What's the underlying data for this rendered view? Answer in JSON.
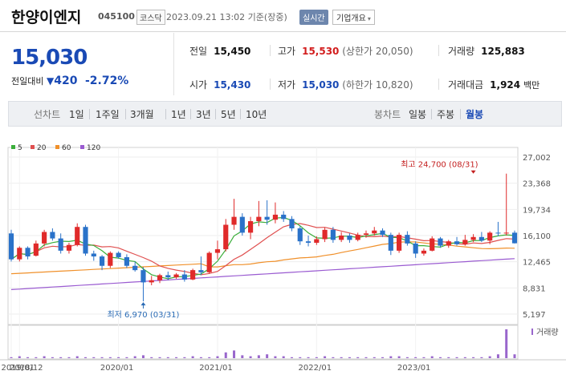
{
  "header": {
    "name": "한양이엔지",
    "code": "045100",
    "market": "코스닥",
    "datetime": "2023.09.21 13:02 기준(장중)",
    "realtime_label": "실시간",
    "company_info": "기업개요"
  },
  "summary": {
    "price": "15,030",
    "change_label": "전일대비",
    "change_arrow": "▼",
    "change_amount": "420",
    "change_pct": "-2.72%",
    "prev_label": "전일",
    "prev_value": "15,450",
    "high_label": "고가",
    "high_value": "15,530",
    "upper_limit": "(상한가 20,050)",
    "volume_label": "거래량",
    "volume_value": "125,883",
    "open_label": "시가",
    "open_value": "15,430",
    "low_label": "저가",
    "low_value": "15,030",
    "lower_limit": "(하한가 10,820)",
    "amount_label": "거래대금",
    "amount_value": "1,924",
    "amount_unit": "백만"
  },
  "periods": {
    "line_label": "선차트",
    "line_items": [
      "1일",
      "1주일",
      "3개월",
      "1년",
      "3년",
      "5년",
      "10년"
    ],
    "candle_label": "봉차트",
    "candle_items": [
      "일봉",
      "주봉",
      "월봉"
    ],
    "selected_candle": "월봉"
  },
  "chart_data": {
    "type": "candlestick",
    "interval": "monthly",
    "legend": [
      {
        "name": "5",
        "color": "#3aae3a"
      },
      {
        "name": "20",
        "color": "#e05050"
      },
      {
        "name": "60",
        "color": "#f0902a"
      },
      {
        "name": "120",
        "color": "#9a5bd1"
      }
    ],
    "colors": {
      "up": "#e02a2a",
      "down": "#2a72c9",
      "ma5": "#3aae3a",
      "ma20": "#e05050",
      "ma60": "#f0902a",
      "ma120": "#9a5bd1",
      "volume": "#9966cc"
    },
    "y_ticks": [
      "27,002",
      "23,368",
      "19,734",
      "16,100",
      "12,465",
      "8,831",
      "5,197"
    ],
    "y_tick_values": [
      27002,
      23368,
      19734,
      16100,
      12465,
      8831,
      5197
    ],
    "ylim": [
      5197,
      27002
    ],
    "x_labels": [
      "2018/12",
      "2019/01",
      "2020/01",
      "2021/01",
      "2022/01",
      "2023/01"
    ],
    "x_label_index": [
      0,
      1,
      13,
      25,
      37,
      49
    ],
    "annotations": {
      "high_label": "최고 24,700 (08/31)",
      "high_value": 24700,
      "high_index": 56,
      "low_label": "최저 6,970 (03/31)",
      "low_value": 6970,
      "low_index": 16
    },
    "volume_label": "거래량",
    "candles": [
      {
        "o": 16400,
        "h": 16900,
        "l": 12500,
        "c": 12800
      },
      {
        "o": 12800,
        "h": 14600,
        "l": 12500,
        "c": 14400
      },
      {
        "o": 14400,
        "h": 14600,
        "l": 12800,
        "c": 13200
      },
      {
        "o": 13300,
        "h": 15400,
        "l": 13200,
        "c": 15000
      },
      {
        "o": 15000,
        "h": 16900,
        "l": 14600,
        "c": 16600
      },
      {
        "o": 16600,
        "h": 17100,
        "l": 15400,
        "c": 15700
      },
      {
        "o": 15700,
        "h": 16400,
        "l": 13600,
        "c": 14000
      },
      {
        "o": 14000,
        "h": 15100,
        "l": 13600,
        "c": 14800
      },
      {
        "o": 14800,
        "h": 17800,
        "l": 14600,
        "c": 17300
      },
      {
        "o": 17300,
        "h": 17600,
        "l": 13300,
        "c": 13600
      },
      {
        "o": 13600,
        "h": 14000,
        "l": 12600,
        "c": 13200
      },
      {
        "o": 13200,
        "h": 13400,
        "l": 11300,
        "c": 11900
      },
      {
        "o": 11900,
        "h": 13900,
        "l": 11600,
        "c": 13700
      },
      {
        "o": 13700,
        "h": 13900,
        "l": 12900,
        "c": 13100
      },
      {
        "o": 13100,
        "h": 13500,
        "l": 11600,
        "c": 11900
      },
      {
        "o": 11900,
        "h": 12500,
        "l": 11100,
        "c": 11300
      },
      {
        "o": 11300,
        "h": 11700,
        "l": 6970,
        "c": 9600
      },
      {
        "o": 9600,
        "h": 10500,
        "l": 9200,
        "c": 9900
      },
      {
        "o": 9900,
        "h": 10800,
        "l": 9500,
        "c": 10600
      },
      {
        "o": 10600,
        "h": 11100,
        "l": 9900,
        "c": 10300
      },
      {
        "o": 10300,
        "h": 10900,
        "l": 10100,
        "c": 10700
      },
      {
        "o": 10700,
        "h": 11300,
        "l": 9700,
        "c": 10000
      },
      {
        "o": 10000,
        "h": 11500,
        "l": 9900,
        "c": 11300
      },
      {
        "o": 11300,
        "h": 13200,
        "l": 10600,
        "c": 11000
      },
      {
        "o": 11000,
        "h": 13900,
        "l": 10800,
        "c": 13700
      },
      {
        "o": 13700,
        "h": 15400,
        "l": 12800,
        "c": 14200
      },
      {
        "o": 14200,
        "h": 18400,
        "l": 13900,
        "c": 17600
      },
      {
        "o": 17600,
        "h": 21200,
        "l": 16900,
        "c": 18700
      },
      {
        "o": 18700,
        "h": 19200,
        "l": 16100,
        "c": 16500
      },
      {
        "o": 16500,
        "h": 18700,
        "l": 15600,
        "c": 18100
      },
      {
        "o": 18100,
        "h": 20900,
        "l": 17400,
        "c": 18700
      },
      {
        "o": 18700,
        "h": 21000,
        "l": 17600,
        "c": 18300
      },
      {
        "o": 18300,
        "h": 20700,
        "l": 17800,
        "c": 19000
      },
      {
        "o": 19000,
        "h": 19500,
        "l": 18000,
        "c": 18400
      },
      {
        "o": 18400,
        "h": 18800,
        "l": 16700,
        "c": 17100
      },
      {
        "o": 17100,
        "h": 17400,
        "l": 14800,
        "c": 15300
      },
      {
        "o": 15300,
        "h": 16100,
        "l": 14600,
        "c": 15100
      },
      {
        "o": 15100,
        "h": 16000,
        "l": 14800,
        "c": 15600
      },
      {
        "o": 15600,
        "h": 17200,
        "l": 15200,
        "c": 16900
      },
      {
        "o": 16900,
        "h": 17300,
        "l": 15100,
        "c": 15500
      },
      {
        "o": 15500,
        "h": 16600,
        "l": 15200,
        "c": 16100
      },
      {
        "o": 16100,
        "h": 16400,
        "l": 15100,
        "c": 15500
      },
      {
        "o": 15500,
        "h": 16500,
        "l": 15300,
        "c": 16200
      },
      {
        "o": 16200,
        "h": 16800,
        "l": 15800,
        "c": 16400
      },
      {
        "o": 16400,
        "h": 17300,
        "l": 16100,
        "c": 16800
      },
      {
        "o": 16800,
        "h": 17100,
        "l": 15900,
        "c": 16200
      },
      {
        "o": 16200,
        "h": 16500,
        "l": 13400,
        "c": 14000
      },
      {
        "o": 14000,
        "h": 16500,
        "l": 13700,
        "c": 16200
      },
      {
        "o": 16200,
        "h": 16700,
        "l": 14700,
        "c": 15000
      },
      {
        "o": 15000,
        "h": 15300,
        "l": 13000,
        "c": 13600
      },
      {
        "o": 13600,
        "h": 14300,
        "l": 13300,
        "c": 14000
      },
      {
        "o": 14000,
        "h": 16000,
        "l": 13900,
        "c": 15700
      },
      {
        "o": 15700,
        "h": 15900,
        "l": 14400,
        "c": 14700
      },
      {
        "o": 14700,
        "h": 15500,
        "l": 14400,
        "c": 15300
      },
      {
        "o": 15300,
        "h": 15900,
        "l": 14700,
        "c": 14900
      },
      {
        "o": 14900,
        "h": 16200,
        "l": 14700,
        "c": 15500
      },
      {
        "o": 15500,
        "h": 16300,
        "l": 15200,
        "c": 15900
      },
      {
        "o": 15900,
        "h": 16600,
        "l": 15200,
        "c": 15400
      },
      {
        "o": 15400,
        "h": 16700,
        "l": 14900,
        "c": 16500
      },
      {
        "o": 16500,
        "h": 18000,
        "l": 16000,
        "c": 16400
      },
      {
        "o": 16400,
        "h": 24700,
        "l": 16100,
        "c": 16500
      },
      {
        "o": 16500,
        "h": 16800,
        "l": 15000,
        "c": 15030
      }
    ],
    "volume": [
      1,
      2,
      1,
      1,
      2,
      1,
      1,
      1,
      2,
      1,
      1,
      1,
      1,
      1,
      1,
      2,
      3,
      1,
      1,
      1,
      1,
      1,
      2,
      1,
      1,
      2,
      6,
      8,
      3,
      2,
      3,
      4,
      2,
      2,
      1,
      1,
      1,
      1,
      2,
      1,
      1,
      1,
      1,
      1,
      1,
      1,
      2,
      2,
      1,
      1,
      1,
      2,
      1,
      1,
      1,
      1,
      1,
      1,
      2,
      4,
      30,
      4
    ]
  }
}
